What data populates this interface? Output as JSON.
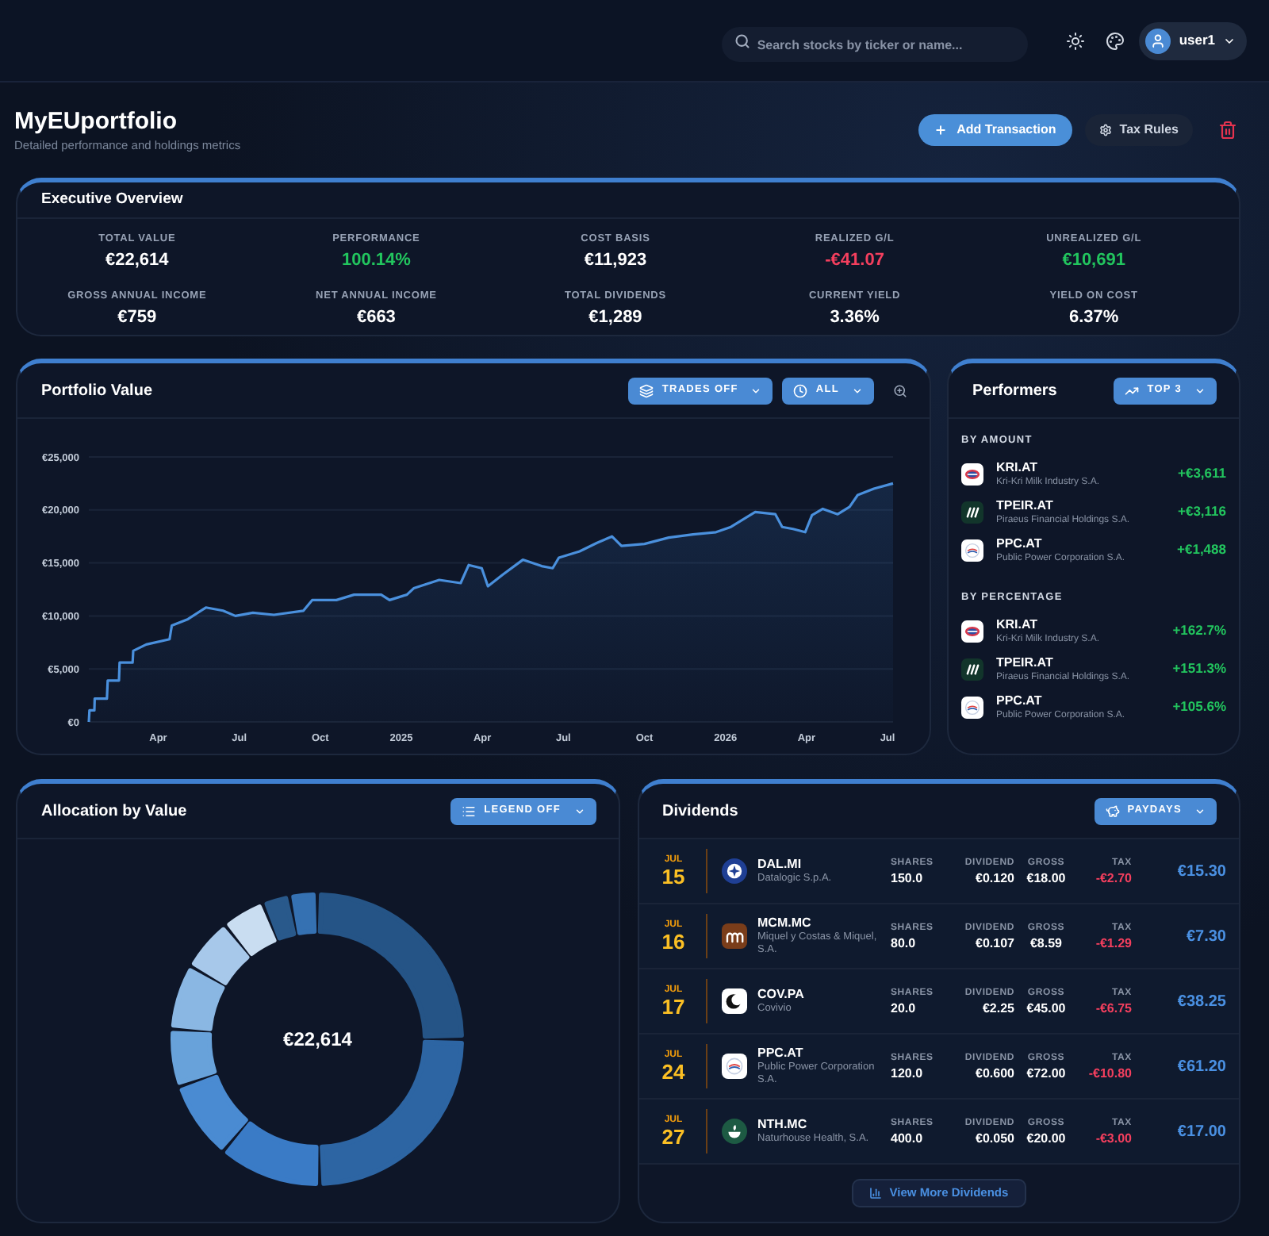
{
  "topbar": {
    "search": {
      "placeholder": "Search stocks by ticker or name..."
    },
    "user": {
      "name": "user1"
    }
  },
  "header": {
    "title": "MyEUportfolio",
    "subtitle": "Detailed performance and holdings metrics",
    "buttons": [
      {
        "label": "Add Transaction",
        "kind": "primary"
      },
      {
        "label": "Tax Rules",
        "kind": "secondary"
      }
    ]
  },
  "overview": {
    "title": "Executive Overview",
    "metrics": [
      {
        "label": "TOTAL VALUE",
        "value": "€22,614",
        "color": "#ffffff"
      },
      {
        "label": "PERFORMANCE",
        "value": "100.14%",
        "color": "#22c55e"
      },
      {
        "label": "COST BASIS",
        "value": "€11,923",
        "color": "#ffffff"
      },
      {
        "label": "REALIZED G/L",
        "value": "-€41.07",
        "color": "#f43f5e"
      },
      {
        "label": "UNREALIZED G/L",
        "value": "€10,691",
        "color": "#22c55e"
      },
      {
        "label": "GROSS ANNUAL INCOME",
        "value": "€759",
        "color": "#ffffff"
      },
      {
        "label": "NET ANNUAL INCOME",
        "value": "€663",
        "color": "#ffffff"
      },
      {
        "label": "TOTAL DIVIDENDS",
        "value": "€1,289",
        "color": "#ffffff"
      },
      {
        "label": "CURRENT YIELD",
        "value": "3.36%",
        "color": "#ffffff"
      },
      {
        "label": "YIELD ON COST",
        "value": "6.37%",
        "color": "#ffffff"
      }
    ]
  },
  "portfolio_value": {
    "title": "Portfolio Value",
    "controls": [
      {
        "label": "TRADES OFF"
      },
      {
        "label": "ALL"
      }
    ],
    "chart_data": {
      "type": "line",
      "x": [
        2024.036,
        2024.038,
        2024.053,
        2024.054,
        2024.092,
        2024.094,
        2024.129,
        2024.131,
        2024.171,
        2024.173,
        2024.213,
        2024.285,
        2024.292,
        2024.342,
        2024.397,
        2024.45,
        2024.488,
        2024.542,
        2024.607,
        2024.698,
        2024.725,
        2024.8,
        2024.854,
        2024.938,
        2024.964,
        2025.017,
        2025.038,
        2025.117,
        2025.183,
        2025.208,
        2025.248,
        2025.267,
        2025.313,
        2025.375,
        2025.433,
        2025.467,
        2025.486,
        2025.55,
        2025.604,
        2025.65,
        2025.679,
        2025.75,
        2025.825,
        2025.9,
        2025.971,
        2026.017,
        2026.092,
        2026.154,
        2026.175,
        2026.208,
        2026.246,
        2026.267,
        2026.3,
        2026.346,
        2026.383,
        2026.408,
        2026.458,
        2026.517
      ],
      "values": [
        0,
        1100,
        1100,
        2200,
        2200,
        3900,
        3900,
        5600,
        5600,
        6700,
        7300,
        7800,
        9100,
        9700,
        10800,
        10500,
        10000,
        10300,
        10100,
        10500,
        11500,
        11500,
        12000,
        12000,
        11500,
        12000,
        12600,
        13400,
        13100,
        14800,
        14500,
        12800,
        13900,
        15300,
        14700,
        14500,
        15500,
        16100,
        16900,
        17500,
        16600,
        16800,
        17400,
        17700,
        17900,
        18400,
        19800,
        19600,
        18400,
        18200,
        17900,
        19500,
        20100,
        19600,
        20300,
        21400,
        22000,
        22500
      ],
      "xlim": [
        2024.036,
        2026.517
      ],
      "ylim": [
        0,
        25000
      ],
      "xticks": [
        {
          "value": 2024.25,
          "label": "Apr"
        },
        {
          "value": 2024.5,
          "label": "Jul"
        },
        {
          "value": 2024.75,
          "label": "Oct"
        },
        {
          "value": 2025,
          "label": "2025"
        },
        {
          "value": 2025.25,
          "label": "Apr"
        },
        {
          "value": 2025.5,
          "label": "Jul"
        },
        {
          "value": 2025.75,
          "label": "Oct"
        },
        {
          "value": 2026,
          "label": "2026"
        },
        {
          "value": 2026.25,
          "label": "Apr"
        },
        {
          "value": 2026.5,
          "label": "Jul"
        }
      ],
      "yticks": [
        {
          "value": 0,
          "label": "€0"
        },
        {
          "value": 5000,
          "label": "€5,000"
        },
        {
          "value": 10000,
          "label": "€10,000"
        },
        {
          "value": 15000,
          "label": "€15,000"
        },
        {
          "value": 20000,
          "label": "€20,000"
        },
        {
          "value": 25000,
          "label": "€25,000"
        }
      ],
      "grid": true
    }
  },
  "performers": {
    "title": "Performers",
    "control": {
      "label": "TOP 3"
    },
    "sections": [
      {
        "heading": "BY AMOUNT",
        "items": [
          {
            "kind": "oval",
            "ticker": "KRI.AT",
            "name": "Kri-Kri Milk Industry S.A.",
            "value": "+€3,611"
          },
          {
            "kind": "slashes",
            "ticker": "TPEIR.AT",
            "name": "Piraeus Financial Holdings S.A.",
            "value": "+€3,116"
          },
          {
            "kind": "ring",
            "ticker": "PPC.AT",
            "name": "Public Power Corporation S.A.",
            "value": "+€1,488"
          }
        ]
      },
      {
        "heading": "BY PERCENTAGE",
        "items": [
          {
            "kind": "oval",
            "ticker": "KRI.AT",
            "name": "Kri-Kri Milk Industry S.A.",
            "value": "+162.7%"
          },
          {
            "kind": "slashes",
            "ticker": "TPEIR.AT",
            "name": "Piraeus Financial Holdings S.A.",
            "value": "+151.3%"
          },
          {
            "kind": "ring",
            "ticker": "PPC.AT",
            "name": "Public Power Corporation S.A.",
            "value": "+105.6%"
          }
        ]
      }
    ]
  },
  "allocation": {
    "title": "Allocation by Value",
    "control": {
      "label": "LEGEND OFF"
    },
    "center_value": "€22,614"
  },
  "dividends": {
    "title": "Dividends",
    "control": {
      "label": "PAYDAYS"
    },
    "rows": [
      {
        "month": "JUL",
        "day": "15",
        "kind": "compass",
        "ticker": "DAL.MI",
        "name": "Datalogic S.p.A.",
        "cells": [
          {
            "label": "SHARES",
            "value": "150.0"
          },
          {
            "label": "DIVIDEND",
            "value": "€0.120"
          },
          {
            "label": "GROSS",
            "value": "€18.00"
          },
          {
            "label": "TAX",
            "value": "-€2.70"
          }
        ],
        "total": "€15.30"
      },
      {
        "month": "JUL",
        "day": "16",
        "kind": "arches",
        "ticker": "MCM.MC",
        "name": "Miquel y Costas & Miquel, S.A.",
        "cells": [
          {
            "label": "SHARES",
            "value": "80.0"
          },
          {
            "label": "DIVIDEND",
            "value": "€0.107"
          },
          {
            "label": "GROSS",
            "value": "€8.59"
          },
          {
            "label": "TAX",
            "value": "-€1.29"
          }
        ],
        "total": "€7.30"
      },
      {
        "month": "JUL",
        "day": "17",
        "kind": "crescent",
        "ticker": "COV.PA",
        "name": "Covivio",
        "cells": [
          {
            "label": "SHARES",
            "value": "20.0"
          },
          {
            "label": "DIVIDEND",
            "value": "€2.25"
          },
          {
            "label": "GROSS",
            "value": "€45.00"
          },
          {
            "label": "TAX",
            "value": "-€6.75"
          }
        ],
        "total": "€38.25"
      },
      {
        "month": "JUL",
        "day": "24",
        "kind": "ring",
        "ticker": "PPC.AT",
        "name": "Public Power Corporation S.A.",
        "cells": [
          {
            "label": "SHARES",
            "value": "120.0"
          },
          {
            "label": "DIVIDEND",
            "value": "€0.600"
          },
          {
            "label": "GROSS",
            "value": "€72.00"
          },
          {
            "label": "TAX",
            "value": "-€10.80"
          }
        ],
        "total": "€61.20"
      },
      {
        "month": "JUL",
        "day": "27",
        "kind": "bowl",
        "ticker": "NTH.MC",
        "name": "Naturhouse Health, S.A.",
        "cells": [
          {
            "label": "SHARES",
            "value": "400.0"
          },
          {
            "label": "DIVIDEND",
            "value": "€0.050"
          },
          {
            "label": "GROSS",
            "value": "€20.00"
          },
          {
            "label": "TAX",
            "value": "-€3.00"
          }
        ],
        "total": "€17.00"
      }
    ],
    "more_button": {
      "label": "View More Dividends"
    }
  }
}
